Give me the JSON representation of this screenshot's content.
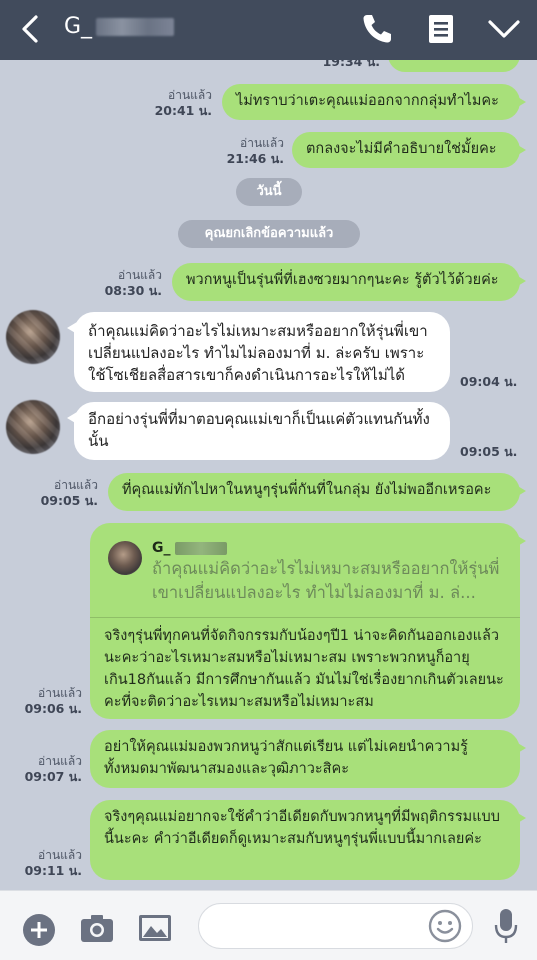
{
  "header": {
    "title": "G_"
  },
  "messages": [
    {
      "side": "out",
      "text": "ไม่ทราบว่าเตะคุณแม่ออกจากกลุ่มทำไมคะ",
      "read": "อ่านแล้ว",
      "time": "20:41 น."
    },
    {
      "side": "out",
      "text": "ตกลงจะไม่มีคำอธิบายใช่มั้ยคะ",
      "read": "อ่านแล้ว",
      "time": "21:46 น."
    },
    {
      "side": "out",
      "text": "พวกหนูเป็นรุ่นพี่ที่เฮงซวยมากๆนะคะ รู้ตัวไว้ด้วยค่ะ",
      "read": "อ่านแล้ว",
      "time": "08:30 น."
    },
    {
      "side": "in",
      "text": "ถ้าคุณแม่คิดว่าอะไรไม่เหมาะสมหรืออยากให้รุ่นพี่เขาเปลี่ยนแปลงอะไร ทำไมไม่ลองมาที่ ม. ล่ะครับ เพราะใช้โซเชียลสื่อสารเขาก็คงดำเนินการอะไรให้ไม่ได้",
      "time": "09:04 น."
    },
    {
      "side": "in",
      "text": "อีกอย่างรุ่นพี่ที่มาตอบคุณแม่เขาก็เป็นแค่ตัวแทนกันทั้งนั้น",
      "time": "09:05 น."
    },
    {
      "side": "out",
      "text": "ที่คุณแม่ทักไปหาในหนูๆรุ่นพี่กันที่ในกลุ่ม ยังไม่พออีกเหรอคะ",
      "read": "อ่านแล้ว",
      "time": "09:05 น."
    },
    {
      "side": "out",
      "text": "จริงๆรุ่นพี่ทุกคนที่จัดกิจกรรมกับน้องๆปี1 น่าจะคิดกันออกเองแล้วนะคะว่าอะไรเหมาะสมหรือไม่เหมาะสม เพราะพวกหนูก็อายุเกิน18กันแล้ว มีการศึกษากันแล้ว มันไม่ใช่เรื่องยากเกินตัวเลยนะคะที่จะติดว่าอะไรเหมาะสมหรือไม่เหมาะสม",
      "read": "อ่านแล้ว",
      "time": "09:06 น.",
      "quote": {
        "name": "G_",
        "text": "ถ้าคุณแม่คิดว่าอะไรไม่เหมาะสมหรืออยากให้รุ่นพี่เขาเปลี่ยนแปลงอะไร ทำไมไม่ลองมาที่ ม. ล่..."
      }
    },
    {
      "side": "out",
      "text": "อย่าให้คุณแม่มองพวกหนูว่าสักแต่เรียน แต่ไม่เคยนำความรู้ทั้งหมดมาพัฒนาสมองและวุฒิภาวะสิคะ",
      "read": "อ่านแล้ว",
      "time": "09:07 น."
    },
    {
      "side": "out",
      "text": "จริงๆคุณแม่อยากจะใช้คำว่าอีเดียดกับพวกหนูๆที่มีพฤติกรรมแบบนี้นะคะ คำว่าอีเดียดก็ดูเหมาะสมกับหนูๆรุ่นพี่แบบนี้มากเลยค่ะ",
      "read": "อ่านแล้ว",
      "time": "09:11 น."
    }
  ],
  "separators": {
    "today": "วันนี้",
    "unsent": "คุณยกเลิกข้อความแล้ว"
  },
  "top_partial_time": "19:34 น.",
  "bottom_bar": {
    "input_placeholder": ""
  },
  "colors": {
    "header_bg": "#414b5c",
    "chat_bg": "#c7cdd9",
    "outgoing_bubble": "#a8e07a",
    "incoming_bubble": "#ffffff"
  },
  "icons": [
    "back-icon",
    "phone-icon",
    "notes-icon",
    "chevron-down-icon",
    "plus-icon",
    "camera-icon",
    "image-icon",
    "emoji-icon",
    "mic-icon"
  ]
}
